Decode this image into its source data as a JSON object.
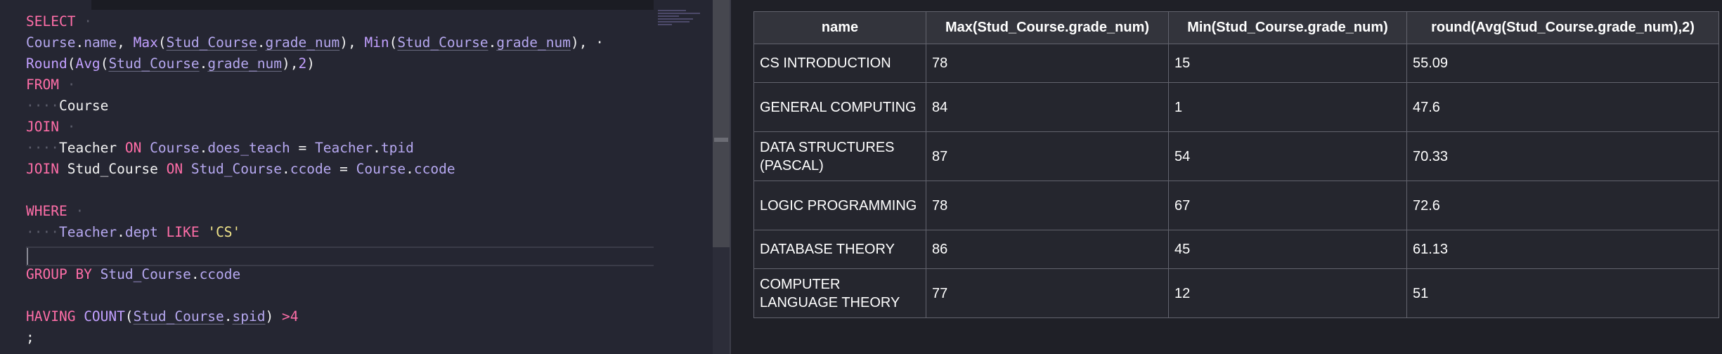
{
  "editor": {
    "lines": [
      [
        {
          "t": "SELECT",
          "c": "kw"
        },
        {
          "t": " ·",
          "c": "dots"
        }
      ],
      [
        {
          "t": "Course",
          "c": "id"
        },
        {
          "t": ".",
          "c": "pl"
        },
        {
          "t": "name",
          "c": "id"
        },
        {
          "t": ", ",
          "c": "pl"
        },
        {
          "t": "Max",
          "c": "fn"
        },
        {
          "t": "(",
          "c": "pl"
        },
        {
          "t": "Stud_Course",
          "c": "id",
          "u": true
        },
        {
          "t": ".",
          "c": "pl"
        },
        {
          "t": "grade_num",
          "c": "id",
          "u": true
        },
        {
          "t": "), ",
          "c": "pl"
        },
        {
          "t": "Min",
          "c": "fn"
        },
        {
          "t": "(",
          "c": "pl"
        },
        {
          "t": "Stud_Course",
          "c": "id",
          "u": true
        },
        {
          "t": ".",
          "c": "pl"
        },
        {
          "t": "grade_num",
          "c": "id",
          "u": true
        },
        {
          "t": "), ·",
          "c": "pl"
        }
      ],
      [
        {
          "t": "Round",
          "c": "fn"
        },
        {
          "t": "(",
          "c": "pl"
        },
        {
          "t": "Avg",
          "c": "fn"
        },
        {
          "t": "(",
          "c": "pl"
        },
        {
          "t": "Stud_Course",
          "c": "id",
          "u": true
        },
        {
          "t": ".",
          "c": "pl"
        },
        {
          "t": "grade_num",
          "c": "id",
          "u": true
        },
        {
          "t": "),",
          "c": "pl"
        },
        {
          "t": "2",
          "c": "nm"
        },
        {
          "t": ")",
          "c": "pl"
        }
      ],
      [
        {
          "t": "FROM",
          "c": "kw"
        },
        {
          "t": " ·",
          "c": "dots"
        }
      ],
      [
        {
          "t": "····",
          "c": "dots"
        },
        {
          "t": "Course",
          "c": "pl"
        }
      ],
      [
        {
          "t": "JOIN",
          "c": "kw"
        },
        {
          "t": " ·",
          "c": "dots"
        }
      ],
      [
        {
          "t": "····",
          "c": "dots"
        },
        {
          "t": "Teacher ",
          "c": "pl"
        },
        {
          "t": "ON ",
          "c": "kw"
        },
        {
          "t": "Course",
          "c": "id"
        },
        {
          "t": ".",
          "c": "pl"
        },
        {
          "t": "does_teach",
          "c": "id"
        },
        {
          "t": " = ",
          "c": "pl"
        },
        {
          "t": "Teacher",
          "c": "id"
        },
        {
          "t": ".",
          "c": "pl"
        },
        {
          "t": "tpid",
          "c": "id"
        }
      ],
      [
        {
          "t": "JOIN ",
          "c": "kw"
        },
        {
          "t": "Stud_Course ",
          "c": "pl"
        },
        {
          "t": "ON ",
          "c": "kw"
        },
        {
          "t": "Stud_Course",
          "c": "id"
        },
        {
          "t": ".",
          "c": "pl"
        },
        {
          "t": "ccode",
          "c": "id"
        },
        {
          "t": " = ",
          "c": "pl"
        },
        {
          "t": "Course",
          "c": "id"
        },
        {
          "t": ".",
          "c": "pl"
        },
        {
          "t": "ccode",
          "c": "id"
        }
      ],
      [],
      [
        {
          "t": "WHERE",
          "c": "kw"
        },
        {
          "t": " ·",
          "c": "dots"
        }
      ],
      [
        {
          "t": "····",
          "c": "dots"
        },
        {
          "t": "Teacher",
          "c": "id"
        },
        {
          "t": ".",
          "c": "pl"
        },
        {
          "t": "dept",
          "c": "id"
        },
        {
          "t": " LIKE ",
          "c": "kw"
        },
        {
          "t": "'CS'",
          "c": "st"
        }
      ],
      [],
      [
        {
          "t": "GROUP BY ",
          "c": "kw"
        },
        {
          "t": "Stud_Course",
          "c": "id"
        },
        {
          "t": ".",
          "c": "pl"
        },
        {
          "t": "ccode",
          "c": "id"
        }
      ],
      [],
      [
        {
          "t": "HAVING ",
          "c": "kw"
        },
        {
          "t": "COUNT",
          "c": "fn"
        },
        {
          "t": "(",
          "c": "pl"
        },
        {
          "t": "Stud_Course",
          "c": "id",
          "u": true
        },
        {
          "t": ".",
          "c": "pl"
        },
        {
          "t": "spid",
          "c": "id",
          "u": true
        },
        {
          "t": ") ",
          "c": "pl"
        },
        {
          "t": ">4",
          "c": "kw"
        }
      ],
      [
        {
          "t": ";",
          "c": "pl"
        }
      ]
    ]
  },
  "results": {
    "columns": [
      "name",
      "Max(Stud_Course.grade_num)",
      "Min(Stud_Course.grade_num)",
      "round(Avg(Stud_Course.grade_num),2)"
    ],
    "rows": [
      [
        "CS INTRODUCTION",
        "78",
        "15",
        "55.09"
      ],
      [
        "GENERAL COMPUTING",
        "84",
        "1",
        "47.6"
      ],
      [
        "DATA STRUCTURES (PASCAL)",
        "87",
        "54",
        "70.33"
      ],
      [
        "LOGIC PROGRAMMING",
        "78",
        "67",
        "72.6"
      ],
      [
        "DATABASE THEORY",
        "86",
        "45",
        "61.13"
      ],
      [
        "COMPUTER LANGUAGE THEORY",
        "77",
        "12",
        "51"
      ]
    ]
  }
}
